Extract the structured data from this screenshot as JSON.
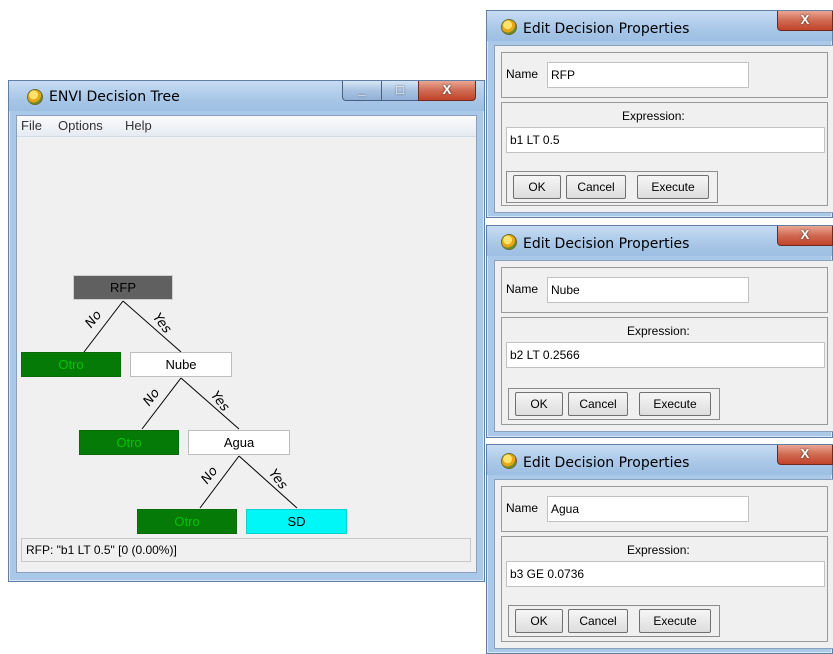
{
  "tree_window": {
    "title": "ENVI Decision Tree",
    "menu": [
      "File",
      "Options",
      "Help"
    ],
    "nodes": {
      "rfp": "RFP",
      "otro1": "Otro",
      "nube": "Nube",
      "otro2": "Otro",
      "agua": "Agua",
      "otro3": "Otro",
      "sd": "SD"
    },
    "branch_no": "No",
    "branch_yes": "Yes",
    "status": "RFP: \"b1 LT 0.5\" [0 (0.00%)]"
  },
  "dialogs": [
    {
      "title": "Edit Decision Properties",
      "name_label": "Name",
      "name_value": "RFP",
      "expression_label": "Expression:",
      "expression_value": "b1 LT 0.5",
      "ok": "OK",
      "cancel": "Cancel",
      "execute": "Execute"
    },
    {
      "title": "Edit Decision Properties",
      "name_label": "Name",
      "name_value": "Nube",
      "expression_label": "Expression:",
      "expression_value": "b2 LT 0.2566",
      "ok": "OK",
      "cancel": "Cancel",
      "execute": "Execute"
    },
    {
      "title": "Edit Decision Properties",
      "name_label": "Name",
      "name_value": "Agua",
      "expression_label": "Expression:",
      "expression_value": "b3 GE  0.0736",
      "ok": "OK",
      "cancel": "Cancel",
      "execute": "Execute"
    }
  ],
  "window_buttons": {
    "minimize": "_",
    "maximize": "□",
    "close": "X"
  },
  "colors": {
    "class_green": "#067a06",
    "class_cyan": "#00f7f7",
    "decision_root": "#606060"
  }
}
